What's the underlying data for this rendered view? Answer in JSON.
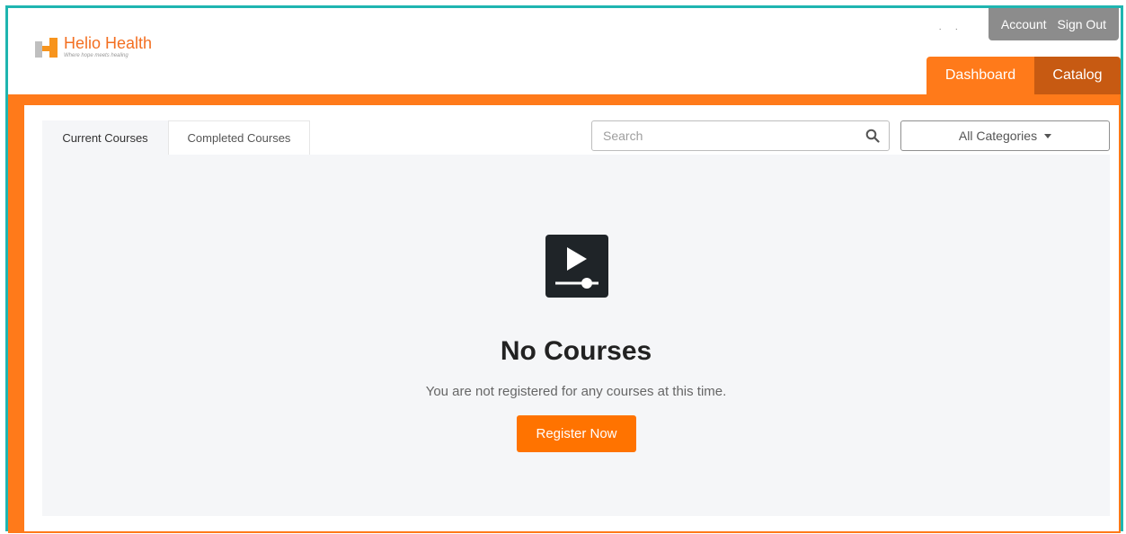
{
  "brand": {
    "name": "Helio Health",
    "tagline": "Where hope meets healing"
  },
  "account_bar": {
    "account_label": "Account",
    "signout_label": "Sign Out"
  },
  "nav": {
    "dashboard_label": "Dashboard",
    "catalog_label": "Catalog"
  },
  "tabs": [
    {
      "label": "Current Courses",
      "active": true
    },
    {
      "label": "Completed Courses",
      "active": false
    }
  ],
  "search": {
    "placeholder": "Search",
    "value": ""
  },
  "category_filter": {
    "selected": "All Categories"
  },
  "empty_state": {
    "icon": "video-player-icon",
    "title": "No Courses",
    "message": "You are not registered for any courses at this time.",
    "button_label": "Register Now"
  },
  "colors": {
    "accent": "#ff7a1a",
    "accent_dark": "#c75a12",
    "frame": "#1fb5b0",
    "account_bar": "#8c8c8c",
    "panel": "#f5f6f8"
  }
}
